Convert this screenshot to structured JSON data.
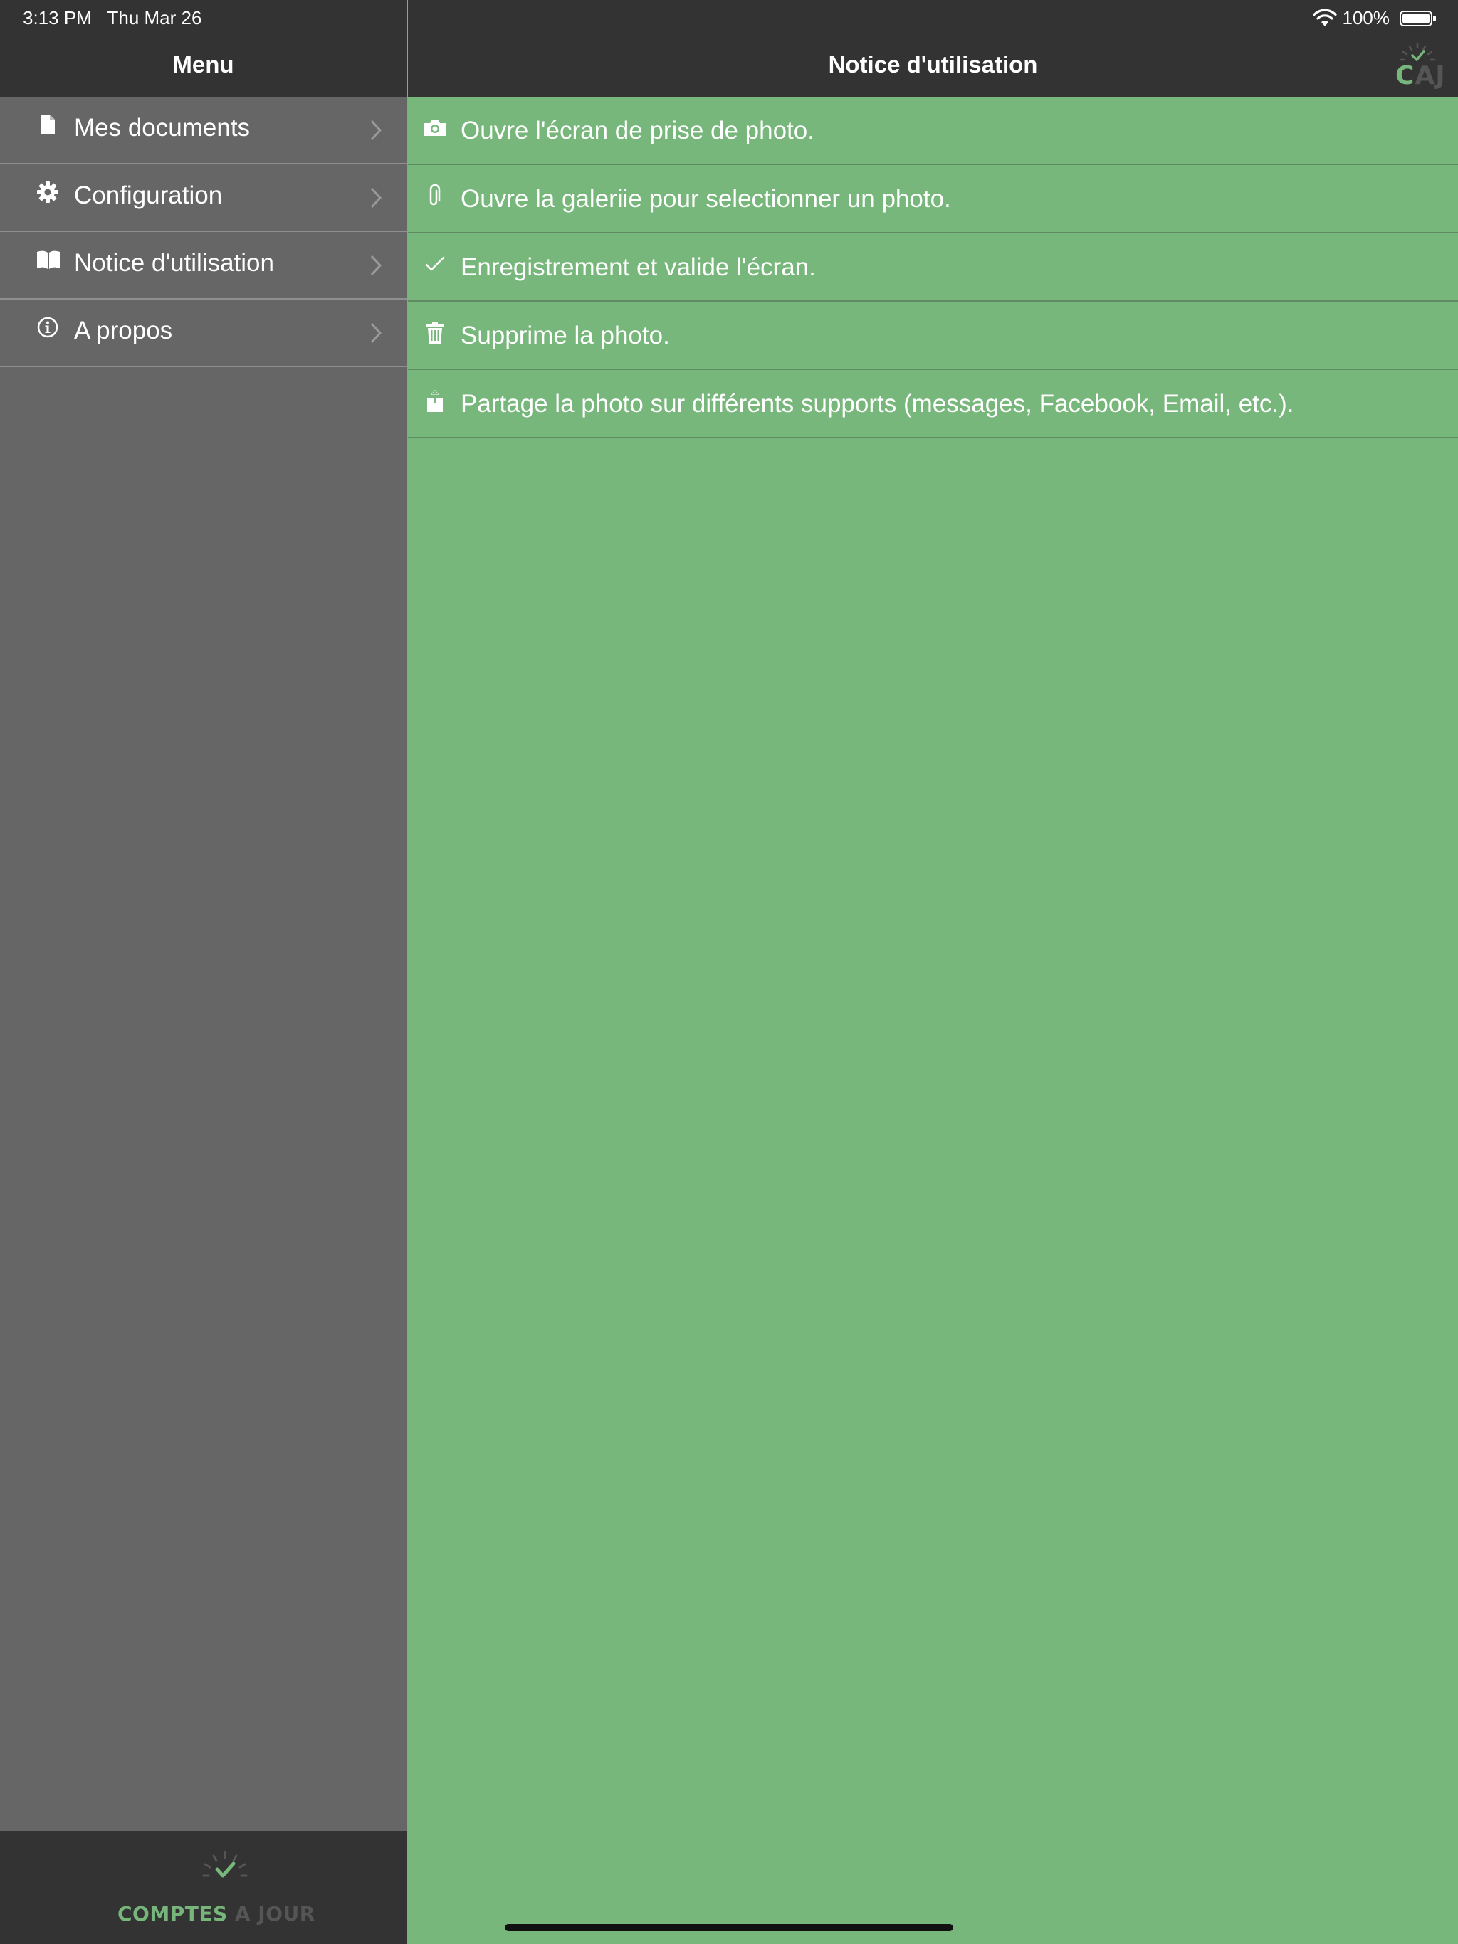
{
  "status_bar": {
    "time": "3:13 PM",
    "date": "Thu Mar 26",
    "battery": "100%",
    "icons": [
      "wifi-icon",
      "battery-icon"
    ]
  },
  "sidebar": {
    "title": "Menu",
    "items": [
      {
        "label": "Mes documents",
        "icon": "document-icon"
      },
      {
        "label": "Configuration",
        "icon": "gear-icon"
      },
      {
        "label": "Notice d'utilisation",
        "icon": "book-icon"
      },
      {
        "label": "A propos",
        "icon": "info-icon"
      }
    ],
    "footer_logo": {
      "word1": "COMPTES",
      "word2": "A JOUR"
    }
  },
  "main": {
    "title": "Notice d'utilisation",
    "header_logo": {
      "letters_green": "C",
      "letters_grey": "AJ"
    },
    "items": [
      {
        "icon": "camera-icon",
        "text": "Ouvre l'écran de prise de photo."
      },
      {
        "icon": "paperclip-icon",
        "text": "Ouvre la galeriie pour selectionner un photo."
      },
      {
        "icon": "checkmark-icon",
        "text": "Enregistrement et valide l'écran."
      },
      {
        "icon": "trash-icon",
        "text": "Supprime la photo."
      },
      {
        "icon": "share-icon",
        "text": "Partage la photo sur différents supports (messages, Facebook, Email, etc.)."
      }
    ]
  },
  "colors": {
    "accent_green": "#78b77b",
    "sidebar_bg": "#666666",
    "header_bg": "#333333",
    "text": "#ffffff"
  }
}
